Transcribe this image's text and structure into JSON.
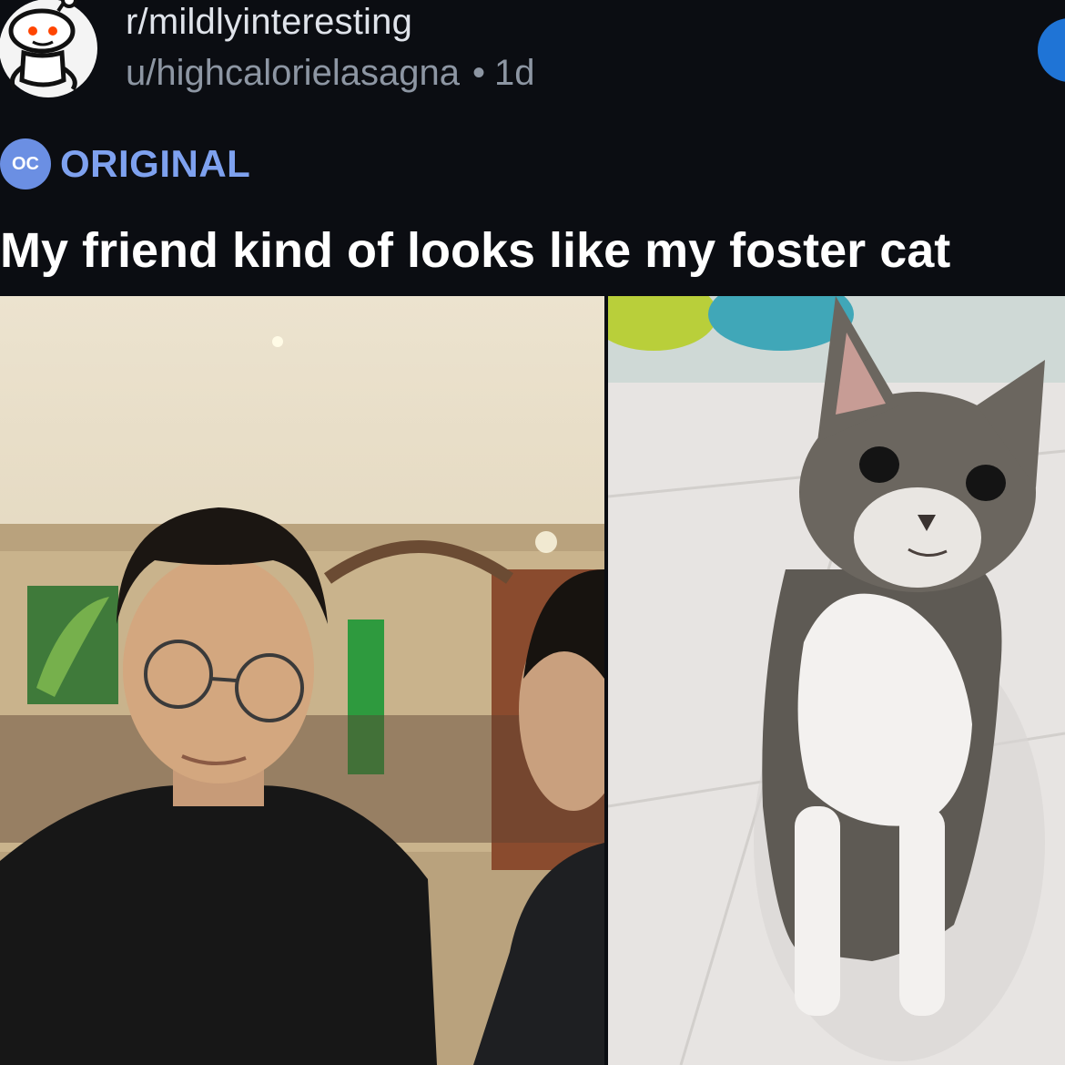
{
  "post": {
    "subreddit": "r/mildlyinteresting",
    "username": "u/highcalorielasagna",
    "separator": "•",
    "age": "1d",
    "flair_badge": "OC",
    "flair_label": "ORIGINAL",
    "title": "My friend kind of looks like my foster cat"
  },
  "colors": {
    "background": "#0b0d12",
    "flair": "#7ea1ef",
    "join_button": "#1f74d6"
  },
  "icons": {
    "avatar": "reddit-snoo-icon"
  }
}
